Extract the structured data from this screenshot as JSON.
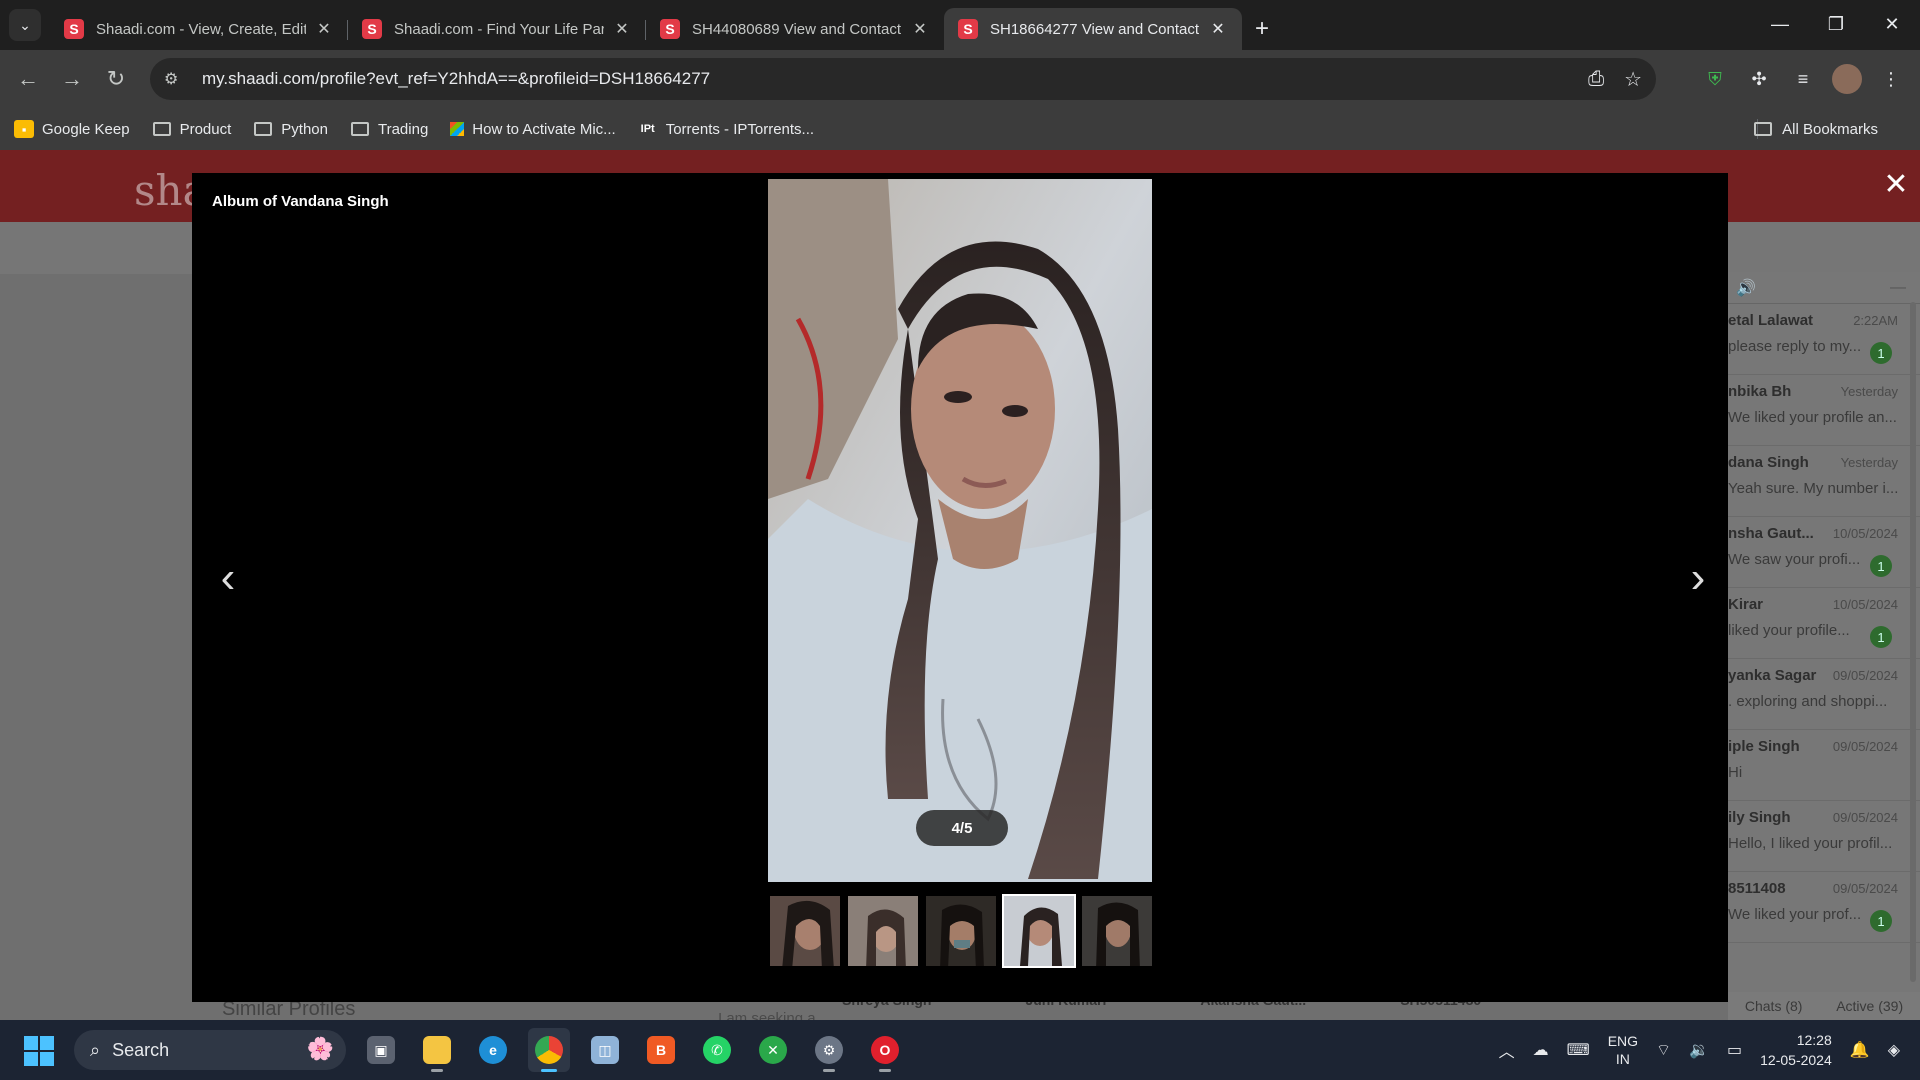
{
  "browser": {
    "tabs": [
      {
        "title": "Shaadi.com - View, Create, Edit,",
        "active": false
      },
      {
        "title": "Shaadi.com - Find Your Life Part",
        "active": false
      },
      {
        "title": "SH44080689 View and Contact",
        "active": false
      },
      {
        "title": "SH18664277 View and Contact",
        "active": true
      }
    ],
    "url": "my.shaadi.com/profile?evt_ref=Y2hhdA==&profileid=DSH18664277",
    "bookmarks": [
      "Google Keep",
      "Product",
      "Python",
      "Trading",
      "How to Activate Mic...",
      "Torrents - IPTorrents..."
    ],
    "all_bookmarks": "All Bookmarks"
  },
  "page": {
    "logo": "sha",
    "similar_profiles": "Similar Profiles",
    "seeking": "I am seeking a",
    "similar_names": [
      "Shreya Singh",
      "Juhi Kumari",
      "Akansha Gaut...",
      "SH50511480"
    ],
    "chats": [
      {
        "name": "etal Lalawat",
        "time": "2:22AM",
        "msg": "please reply to my...",
        "badge": "1"
      },
      {
        "name": "nbika Bh",
        "time": "Yesterday",
        "msg": "We liked your profile an...",
        "badge": ""
      },
      {
        "name": "dana Singh",
        "time": "Yesterday",
        "msg": "Yeah sure. My number i...",
        "badge": ""
      },
      {
        "name": "nsha Gaut...",
        "time": "10/05/2024",
        "msg": "We saw your profi...",
        "badge": "1"
      },
      {
        "name": "Kirar",
        "time": "10/05/2024",
        "msg": "liked your profile...",
        "badge": "1"
      },
      {
        "name": "yanka Sagar",
        "time": "09/05/2024",
        "msg": ". exploring and shoppi...",
        "badge": ""
      },
      {
        "name": "iple Singh",
        "time": "09/05/2024",
        "msg": "Hi",
        "badge": ""
      },
      {
        "name": "ily Singh",
        "time": "09/05/2024",
        "msg": "Hello, I liked your profil...",
        "badge": ""
      },
      {
        "name": "8511408",
        "time": "09/05/2024",
        "msg": "We liked your prof...",
        "badge": "1"
      }
    ],
    "chats_tab": "Chats (8)",
    "active_tab": "Active (39)"
  },
  "modal": {
    "title": "Album of Vandana Singh",
    "counter": "4/5",
    "selected_index": 3,
    "thumb_count": 5
  },
  "taskbar": {
    "search": "Search",
    "lang_top": "ENG",
    "lang_bottom": "IN",
    "time": "12:28",
    "date": "12-05-2024"
  }
}
